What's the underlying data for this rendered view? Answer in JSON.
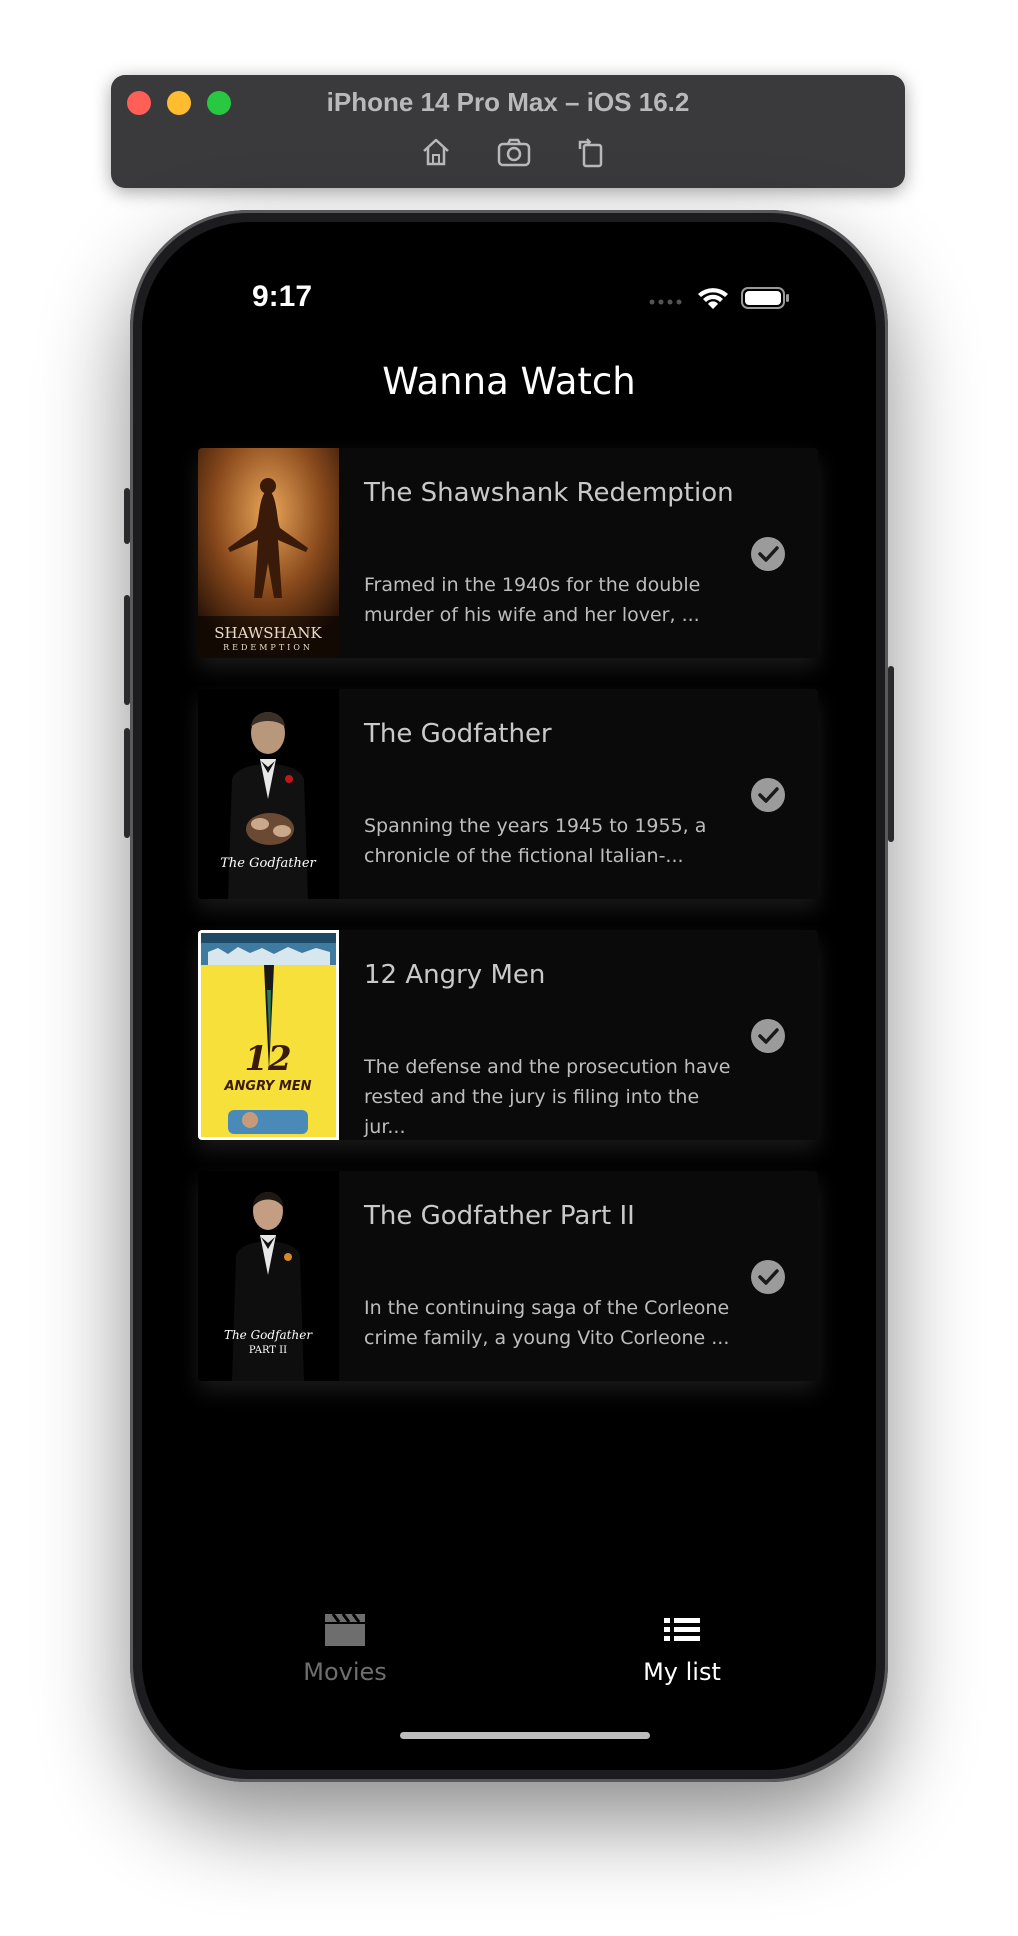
{
  "simulator": {
    "title": "iPhone 14 Pro Max – iOS 16.2",
    "tools": [
      {
        "icon": "home-icon"
      },
      {
        "icon": "screenshot-icon"
      },
      {
        "icon": "rotate-icon"
      }
    ]
  },
  "status_bar": {
    "time": "9:17",
    "icons": [
      "signal-icon",
      "wifi-icon",
      "battery-icon"
    ]
  },
  "app": {
    "title": "Wanna Watch"
  },
  "movies": [
    {
      "title": "The Shawshank Redemption",
      "description": "Framed in the 1940s for the double murder of his wife and her lover, ...",
      "poster_text": "SHAWSHANK",
      "poster_subtext": "REDEMPTION",
      "checked": true
    },
    {
      "title": "The Godfather",
      "description": "Spanning the years 1945 to 1955, a chronicle of the fictional Italian-...",
      "poster_text": "The Godfather",
      "checked": true
    },
    {
      "title": "12 Angry Men",
      "description": "The defense and the prosecution have rested and the jury is filing into the jur...",
      "poster_text": "12",
      "poster_subtext": "ANGRY MEN",
      "checked": true
    },
    {
      "title": "The Godfather Part II",
      "description": "In the continuing saga of the Corleone crime family, a young Vito Corleone ...",
      "poster_text": "The Godfather",
      "poster_subtext": "PART II",
      "checked": true
    }
  ],
  "tabs": [
    {
      "label": "Movies",
      "icon": "clapperboard-icon",
      "active": false
    },
    {
      "label": "My list",
      "icon": "list-icon",
      "active": true
    }
  ],
  "colors": {
    "background": "#000000",
    "card": "#0a0a0a",
    "text_primary": "#ffffff",
    "text_muted": "#8e8e93",
    "check": "#9b9b9b"
  }
}
